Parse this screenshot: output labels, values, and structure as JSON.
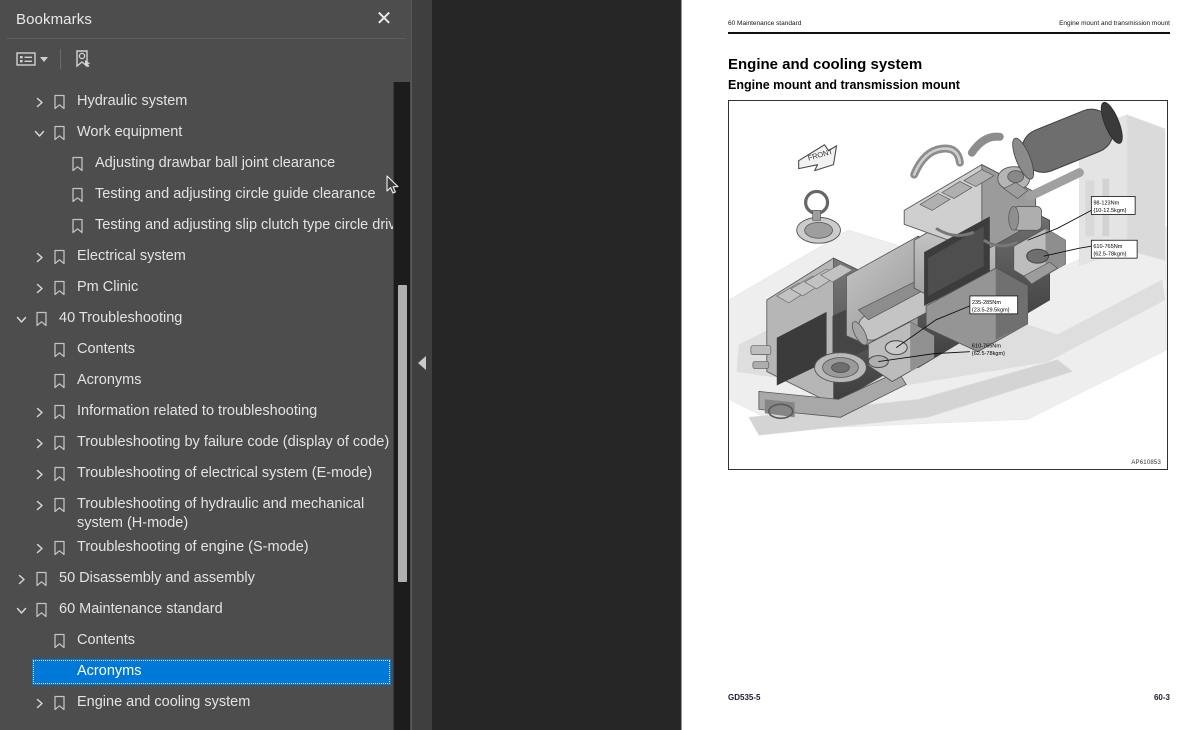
{
  "panel": {
    "title": "Bookmarks",
    "close_icon": "close-icon",
    "toolbar": {
      "options_icon": "list-options-icon",
      "new_bookmark_icon": "new-bookmark-icon"
    }
  },
  "tree": {
    "items": [
      {
        "label": "Hydraulic system",
        "level": 1,
        "twisty": "collapsed",
        "selected": false
      },
      {
        "label": "Work equipment",
        "level": 1,
        "twisty": "expanded",
        "selected": false
      },
      {
        "label": "Adjusting drawbar ball joint clearance",
        "level": 2,
        "twisty": "none",
        "selected": false
      },
      {
        "label": "Testing and adjusting circle guide clearance",
        "level": 2,
        "twisty": "none",
        "selected": false
      },
      {
        "label": "Testing and adjusting slip clutch type circle drive",
        "level": 2,
        "twisty": "none",
        "selected": false
      },
      {
        "label": "Electrical system",
        "level": 1,
        "twisty": "collapsed",
        "selected": false
      },
      {
        "label": "Pm Clinic",
        "level": 1,
        "twisty": "collapsed",
        "selected": false
      },
      {
        "label": "40 Troubleshooting",
        "level": 0,
        "twisty": "expanded",
        "selected": false
      },
      {
        "label": "Contents",
        "level": 1,
        "twisty": "none",
        "selected": false
      },
      {
        "label": "Acronyms",
        "level": 1,
        "twisty": "none",
        "selected": false
      },
      {
        "label": "Information related to troubleshooting",
        "level": 1,
        "twisty": "collapsed",
        "selected": false
      },
      {
        "label": "Troubleshooting by failure code (display of code)",
        "level": 1,
        "twisty": "collapsed",
        "selected": false
      },
      {
        "label": "Troubleshooting of electrical system (E-mode)",
        "level": 1,
        "twisty": "collapsed",
        "selected": false
      },
      {
        "label": "Troubleshooting of hydraulic and mechanical system (H-mode)",
        "level": 1,
        "twisty": "collapsed",
        "selected": false,
        "wrap": true
      },
      {
        "label": "Troubleshooting of engine (S-mode)",
        "level": 1,
        "twisty": "collapsed",
        "selected": false
      },
      {
        "label": "50 Disassembly and assembly",
        "level": 0,
        "twisty": "collapsed",
        "selected": false
      },
      {
        "label": "60 Maintenance standard",
        "level": 0,
        "twisty": "expanded",
        "selected": false
      },
      {
        "label": "Contents",
        "level": 1,
        "twisty": "none",
        "selected": false
      },
      {
        "label": "Acronyms",
        "level": 1,
        "twisty": "none",
        "selected": true
      },
      {
        "label": "Engine and cooling system",
        "level": 1,
        "twisty": "collapsed",
        "selected": false
      }
    ],
    "selection_color": "#0078d7"
  },
  "splitter": {
    "collapse_icon": "collapse-left-triangle-icon"
  },
  "document": {
    "header_left": "60 Maintenance standard",
    "header_right": "Engine mount and transmission mount",
    "heading": "Engine and cooling system",
    "subheading": "Engine mount and transmission mount",
    "figure": {
      "direction_label": "FRONT",
      "figure_id": "AP610853",
      "callouts": [
        {
          "line1": "98-123Nm",
          "line2": "{10-12.5kgm}"
        },
        {
          "line1": "610-765Nm",
          "line2": "{62.5-78kgm}"
        },
        {
          "line1": "235-285Nm",
          "line2": "{23.5-29.5kgm}"
        },
        {
          "line1": "610-765Nm",
          "line2": "{62.5-78kgm}"
        }
      ]
    },
    "footer_left": "GD535-5",
    "footer_right": "60-3"
  }
}
